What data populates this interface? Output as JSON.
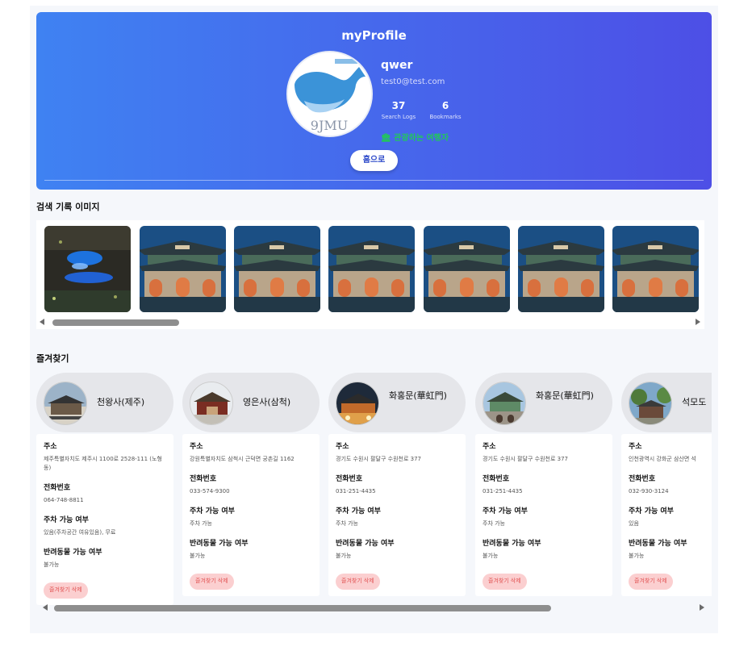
{
  "header": {
    "title": "myProfile",
    "user_name": "qwer",
    "email": "test0@test.com",
    "stats": [
      {
        "value": "37",
        "label": "Search Logs"
      },
      {
        "value": "6",
        "label": "Bookmarks"
      }
    ],
    "badge": "🏛 관광하는 여행자",
    "home_button": "홈으로",
    "avatar_caption": "9JMU"
  },
  "search_images": {
    "title": "검색 기록 이미지",
    "items": [
      "cave-light",
      "gyeongbok-gate",
      "gyeongbok-gate",
      "gyeongbok-gate",
      "gyeongbok-gate",
      "gyeongbok-gate",
      "gyeongbok-gate"
    ]
  },
  "bookmarks": {
    "title": "즐겨찾기",
    "field_labels": {
      "address": "주소",
      "phone": "전화번호",
      "parking": "주차 가능 여부",
      "pets": "반려동물 가능 여부"
    },
    "delete_label": "즐겨찾기 삭제",
    "items": [
      {
        "name": "천왕사(제주)",
        "address": "제주특별자치도 제주시 1100로 2528-111 (노형동)",
        "phone": "064-748-8811",
        "parking": "있음(주차공간 여유있음), 무료",
        "pets": "불가능"
      },
      {
        "name": "영은사(삼척)",
        "address": "강원특별자치도 삼척시 근덕면 궁촌길 1162",
        "phone": "033-574-9300",
        "parking": "주차 가능",
        "pets": "불가능"
      },
      {
        "name": "화홍문(華虹門)",
        "address": "경기도 수원시 팔달구 수원천로 377",
        "phone": "031-251-4435",
        "parking": "주차 가능",
        "pets": "불가능"
      },
      {
        "name": "화홍문(華虹門)",
        "address": "경기도 수원시 팔달구 수원천로 377",
        "phone": "031-251-4435",
        "parking": "주차 가능",
        "pets": "불가능"
      },
      {
        "name": "석모도",
        "address": "인천광역시 강화군 삼산면 석",
        "phone": "032-930-3124",
        "parking": "있음",
        "pets": "불가능"
      }
    ]
  }
}
